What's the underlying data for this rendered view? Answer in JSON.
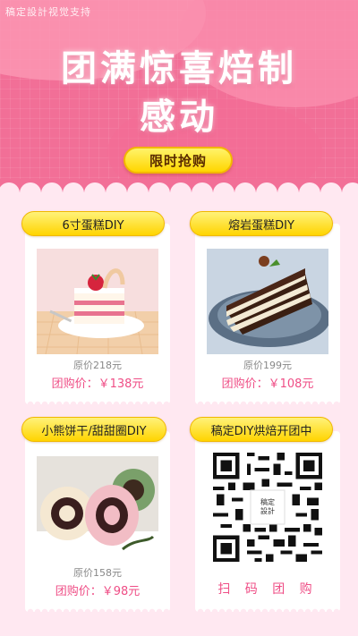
{
  "watermark": "稿定設計视觉支持",
  "hero": {
    "title_line1": "团满惊喜焙制",
    "title_line2": "感动",
    "cta_label": "限时抢购"
  },
  "products": [
    {
      "name": "6寸蛋糕DIY",
      "original_price": "原价218元",
      "group_price": "团购价：￥138元",
      "image": "strawberry-layer-cake"
    },
    {
      "name": "熔岩蛋糕DIY",
      "original_price": "原价199元",
      "group_price": "团购价：￥108元",
      "image": "chocolate-lava-cake"
    },
    {
      "name": "小熊饼干/甜甜圈DIY",
      "original_price": "原价158元",
      "group_price": "团购价：￥98元",
      "image": "swiss-roll-slices"
    }
  ],
  "qr_card": {
    "title": "稿定DIY烘焙开团中",
    "center_logo_line1": "稿定",
    "center_logo_line2": "設計",
    "scan_label": "扫 码 团 购"
  },
  "colors": {
    "hero_pink": "#f26f97",
    "background": "#ffe8f1",
    "accent_yellow": "#ffd600",
    "price_pink": "#ef4e86"
  }
}
